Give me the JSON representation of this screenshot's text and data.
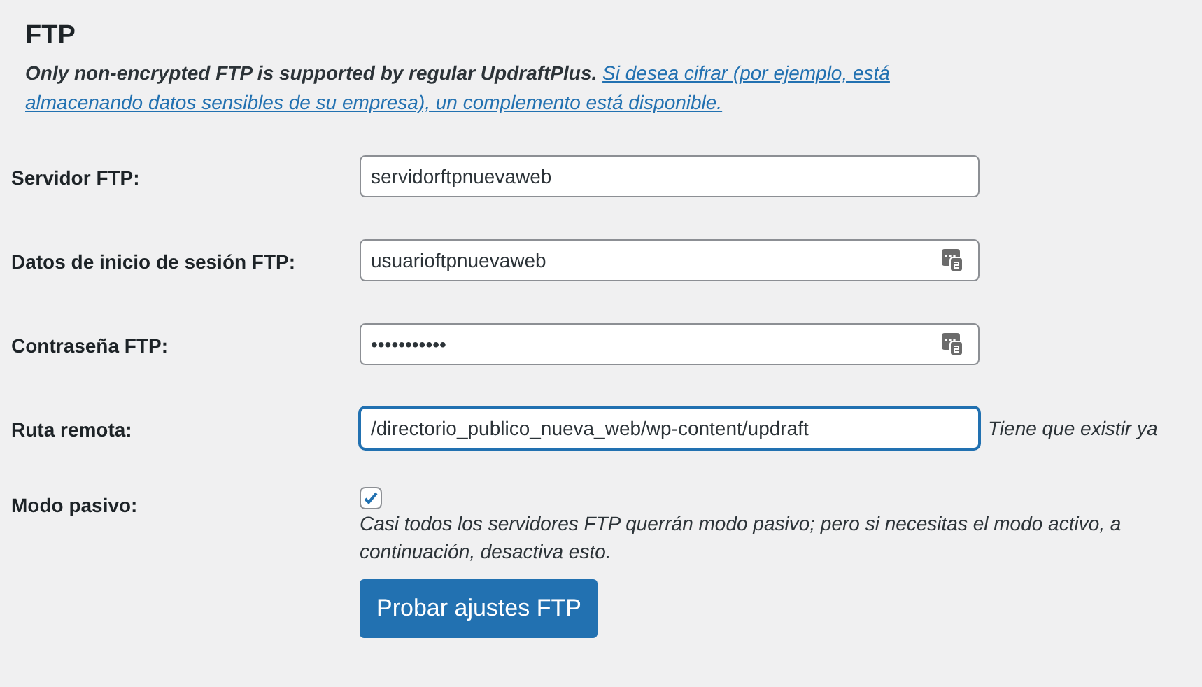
{
  "section": {
    "title": "FTP",
    "notice": "Only non-encrypted FTP is supported by regular UpdraftPlus.",
    "notice_link": [
      "Si desea cifrar (por ejemplo, está",
      "almacenando datos sensibles de su empresa), un complemento está disponible."
    ]
  },
  "rows": [
    {
      "kind": "text",
      "label": "Servidor FTP:",
      "value": "servidorftpnuevaweb",
      "focused": false,
      "autofill_icon": false
    },
    {
      "kind": "text",
      "label": "Datos de inicio de sesión FTP:",
      "value": "usuarioftpnuevaweb",
      "focused": false,
      "autofill_icon": true
    },
    {
      "kind": "text",
      "label": "Contraseña FTP:",
      "value": "•••••••••••",
      "focused": false,
      "autofill_icon": true
    },
    {
      "kind": "text",
      "label": "Ruta remota:",
      "value": "/directorio_publico_nueva_web/wp-content/updraft",
      "focused": true,
      "autofill_icon": false,
      "hint": "Tiene que existir ya"
    },
    {
      "kind": "checkbox",
      "label": "Modo pasivo:",
      "checked": true,
      "description": "Casi todos los servidores FTP querrán modo pasivo; pero si necesitas el modo activo, a continuación, desactiva esto."
    }
  ],
  "button": "Probar ajustes FTP"
}
